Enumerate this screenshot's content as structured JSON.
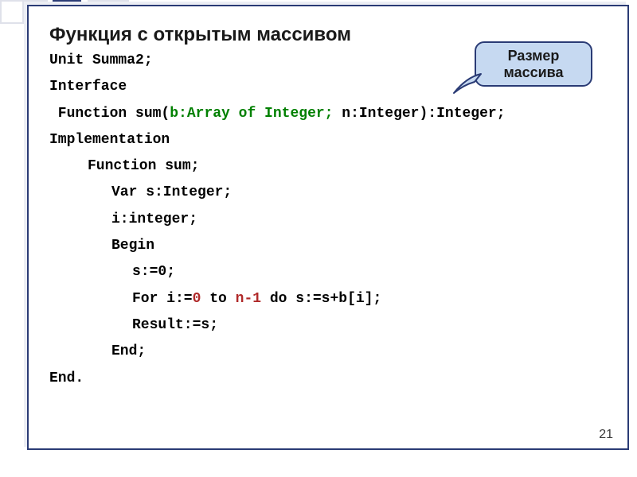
{
  "title": "Функция с открытым массивом",
  "callout": {
    "line1": "Размер",
    "line2": "массива"
  },
  "code": {
    "l1": "Unit Summa2;",
    "l2": "Interface",
    "l3a": " Function sum(",
    "l3b": "b:Array of Integer;",
    "l3c": " n:Integer):Integer;",
    "l4": "Implementation",
    "l5": "Function sum;",
    "l6": "Var s:Integer;",
    "l7": "i:integer;",
    "l8": "Begin",
    "l9": "s:=0;",
    "l10a": "For i:=",
    "l10b": "0",
    "l10c": " to ",
    "l10d": "n-1",
    "l10e": " do s:=s+b[i];",
    "l11": "Result:=s;",
    "l12": "End;",
    "l13": "End."
  },
  "page_number": "21"
}
